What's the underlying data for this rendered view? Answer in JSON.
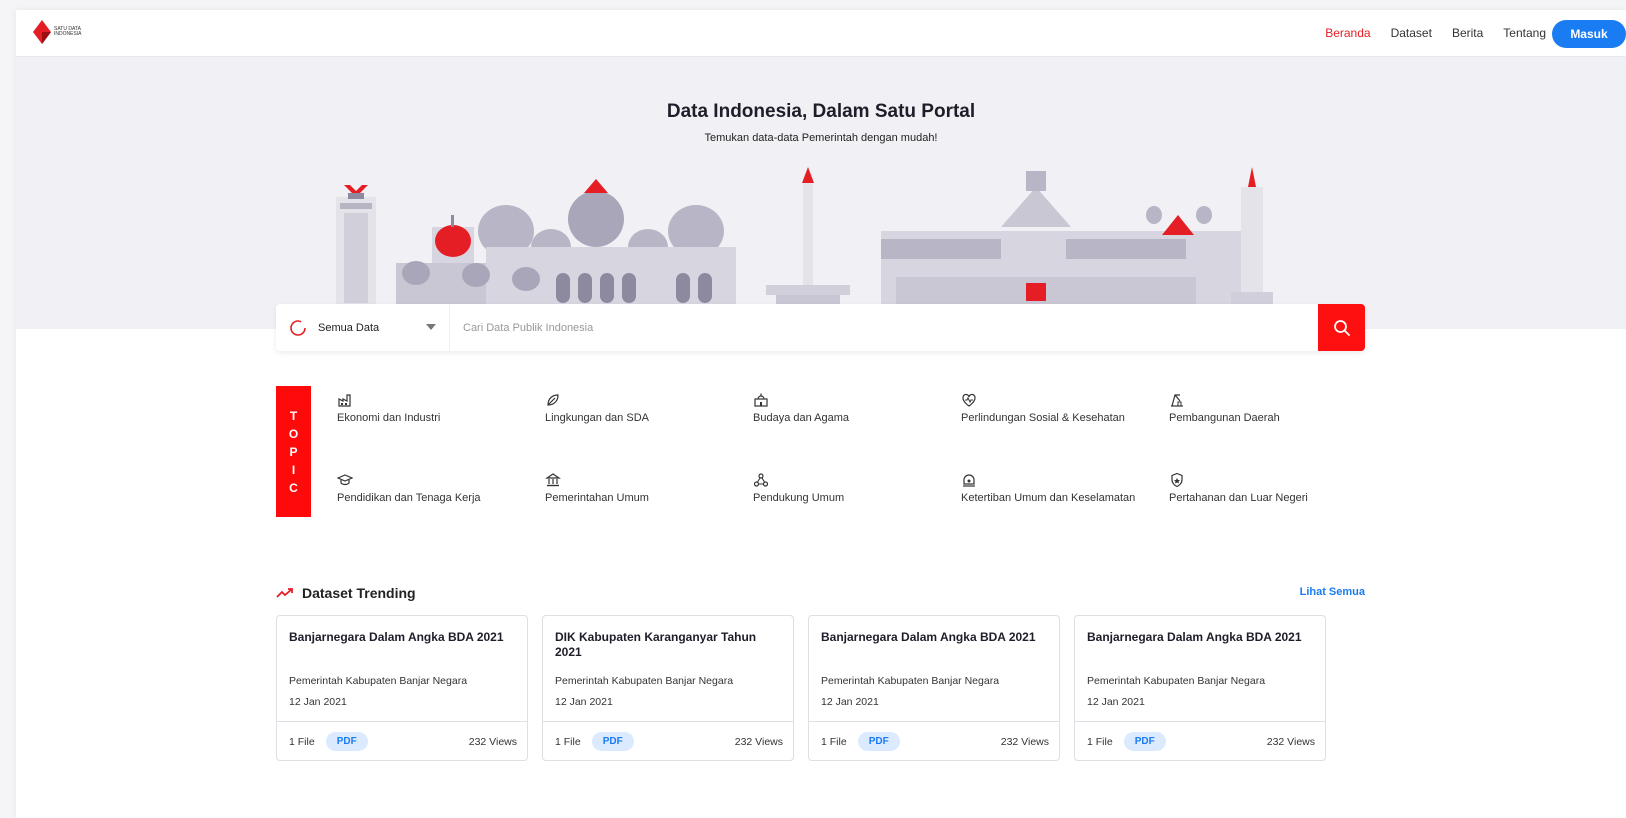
{
  "header": {
    "logo_text": "SATU DATA INDONESIA",
    "nav": [
      "Beranda",
      "Dataset",
      "Berita",
      "Tentang"
    ],
    "active_nav": "Beranda",
    "login_label": "Masuk"
  },
  "hero": {
    "title": "Data Indonesia, Dalam Satu  Portal",
    "subtitle": "Temukan data-data Pemerintah dengan mudah!"
  },
  "search": {
    "category": "Semua Data",
    "placeholder": "Cari Data Publik Indonesia"
  },
  "topics": {
    "tag": [
      "T",
      "O",
      "P",
      "I",
      "C"
    ],
    "items": [
      {
        "label": "Ekonomi dan Industri",
        "icon": "factory-icon"
      },
      {
        "label": "Lingkungan dan SDA",
        "icon": "leaf-icon"
      },
      {
        "label": "Budaya dan Agama",
        "icon": "mosque-icon"
      },
      {
        "label": "Perlindungan Sosial & Kesehatan",
        "icon": "heart-pulse-icon"
      },
      {
        "label": "Pembangunan Daerah",
        "icon": "crane-icon"
      },
      {
        "label": "Pendidikan dan Tenaga Kerja",
        "icon": "graduation-cap-icon"
      },
      {
        "label": "Pemerintahan Umum",
        "icon": "government-building-icon"
      },
      {
        "label": "Pendukung Umum",
        "icon": "network-icon"
      },
      {
        "label": "Ketertiban Umum dan Keselamatan",
        "icon": "siren-icon"
      },
      {
        "label": "Pertahanan dan Luar Negeri",
        "icon": "shield-icon"
      }
    ]
  },
  "trending": {
    "title": "Dataset Trending",
    "see_all": "Lihat Semua",
    "cards": [
      {
        "title": "Banjarnegara Dalam Angka BDA 2021",
        "org": "Pemerintah Kabupaten Banjar Negara",
        "date": "12 Jan 2021",
        "files": "1 File",
        "format": "PDF",
        "views": "232 Views"
      },
      {
        "title": "DIK Kabupaten Karanganyar Tahun 2021",
        "org": "Pemerintah Kabupaten Banjar Negara",
        "date": "12 Jan 2021",
        "files": "1 File",
        "format": "PDF",
        "views": "232 Views"
      },
      {
        "title": "Banjarnegara Dalam Angka BDA 2021",
        "org": "Pemerintah Kabupaten Banjar Negara",
        "date": "12 Jan 2021",
        "files": "1 File",
        "format": "PDF",
        "views": "232 Views"
      },
      {
        "title": "Banjarnegara Dalam Angka BDA 2021",
        "org": "Pemerintah Kabupaten Banjar Negara",
        "date": "12 Jan 2021",
        "files": "1 File",
        "format": "PDF",
        "views": "232 Views"
      }
    ]
  },
  "colors": {
    "brand_red": "#ff0a0a",
    "accent_blue": "#1a7cf2"
  }
}
